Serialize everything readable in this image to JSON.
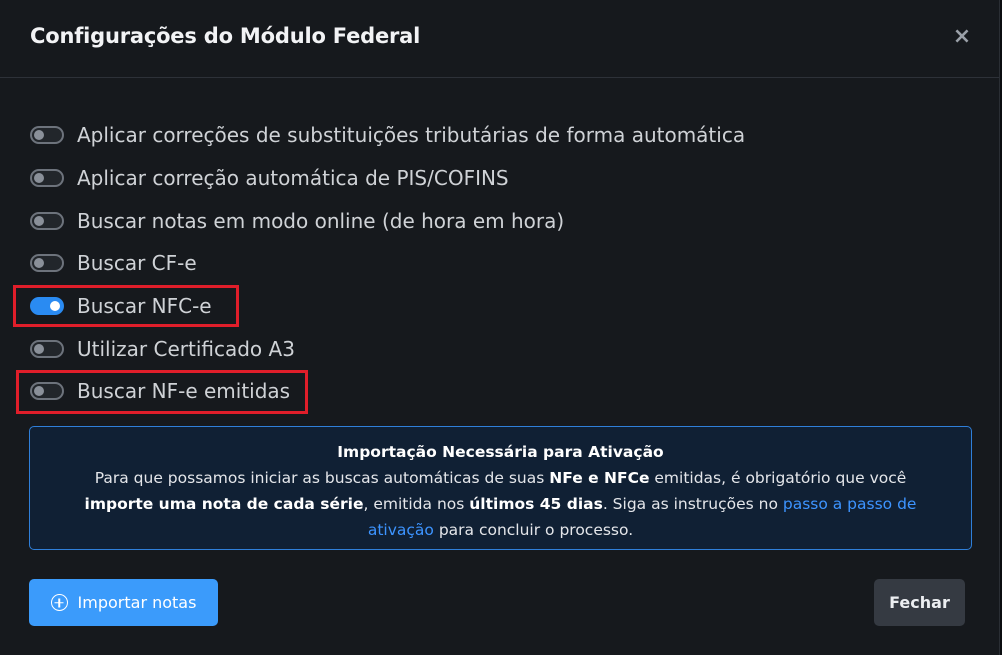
{
  "modal": {
    "title": "Configurações do Módulo Federal",
    "close_icon": "×"
  },
  "options": [
    {
      "label": "Aplicar correções de substituições tributárias de forma automática",
      "enabled": false
    },
    {
      "label": "Aplicar correção automática de PIS/COFINS",
      "enabled": false
    },
    {
      "label": "Buscar notas em modo online (de hora em hora)",
      "enabled": false
    },
    {
      "label": "Buscar CF-e",
      "enabled": false
    },
    {
      "label": "Buscar NFC-e",
      "enabled": true
    },
    {
      "label": "Utilizar Certificado A3",
      "enabled": false
    },
    {
      "label": "Buscar NF-e emitidas",
      "enabled": false
    }
  ],
  "info": {
    "title": "Importação Necessária para Ativação",
    "l1_a": "Para que possamos iniciar as buscas automáticas de suas ",
    "l1_b": "NFe e NFCe",
    "l1_c": " emitidas, é obrigatório que você",
    "l2_a": "importe uma nota de cada série",
    "l2_b": ", emitida nos ",
    "l2_c": "últimos 45 dias",
    "l2_d": ". Siga as instruções no ",
    "l2_link": "passo a passo de",
    "l3_link": "ativação",
    "l3_b": " para concluir o processo."
  },
  "footer": {
    "import_label": "Importar notas",
    "close_label": "Fechar"
  },
  "colors": {
    "accent": "#3b9bfb",
    "highlight": "#e01e2a",
    "info_border": "#2f7fd9"
  }
}
